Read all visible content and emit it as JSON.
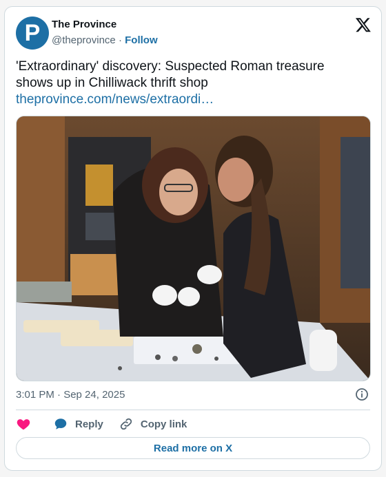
{
  "account": {
    "name": "The Province",
    "handle": "@theprovince",
    "separator": "·",
    "follow_label": "Follow",
    "avatar_letter": "P",
    "avatar_color": "#1d6fa5"
  },
  "post": {
    "text": "'Extraordinary' discovery: Suspected Roman treasure shows up in Chilliwack thrift shop",
    "link_text": "theprovince.com/news/extraordi…",
    "timestamp": "3:01 PM · Sep 24, 2025"
  },
  "actions": {
    "like_icon": "heart-icon",
    "reply_label": "Reply",
    "reply_icon": "speech-bubble-icon",
    "copy_label": "Copy link",
    "copy_icon": "link-icon"
  },
  "read_more_label": "Read more on X",
  "colors": {
    "link": "#1d6fa5",
    "heart": "#f91880",
    "border": "#cfd9de",
    "secondary_text": "#536471"
  }
}
